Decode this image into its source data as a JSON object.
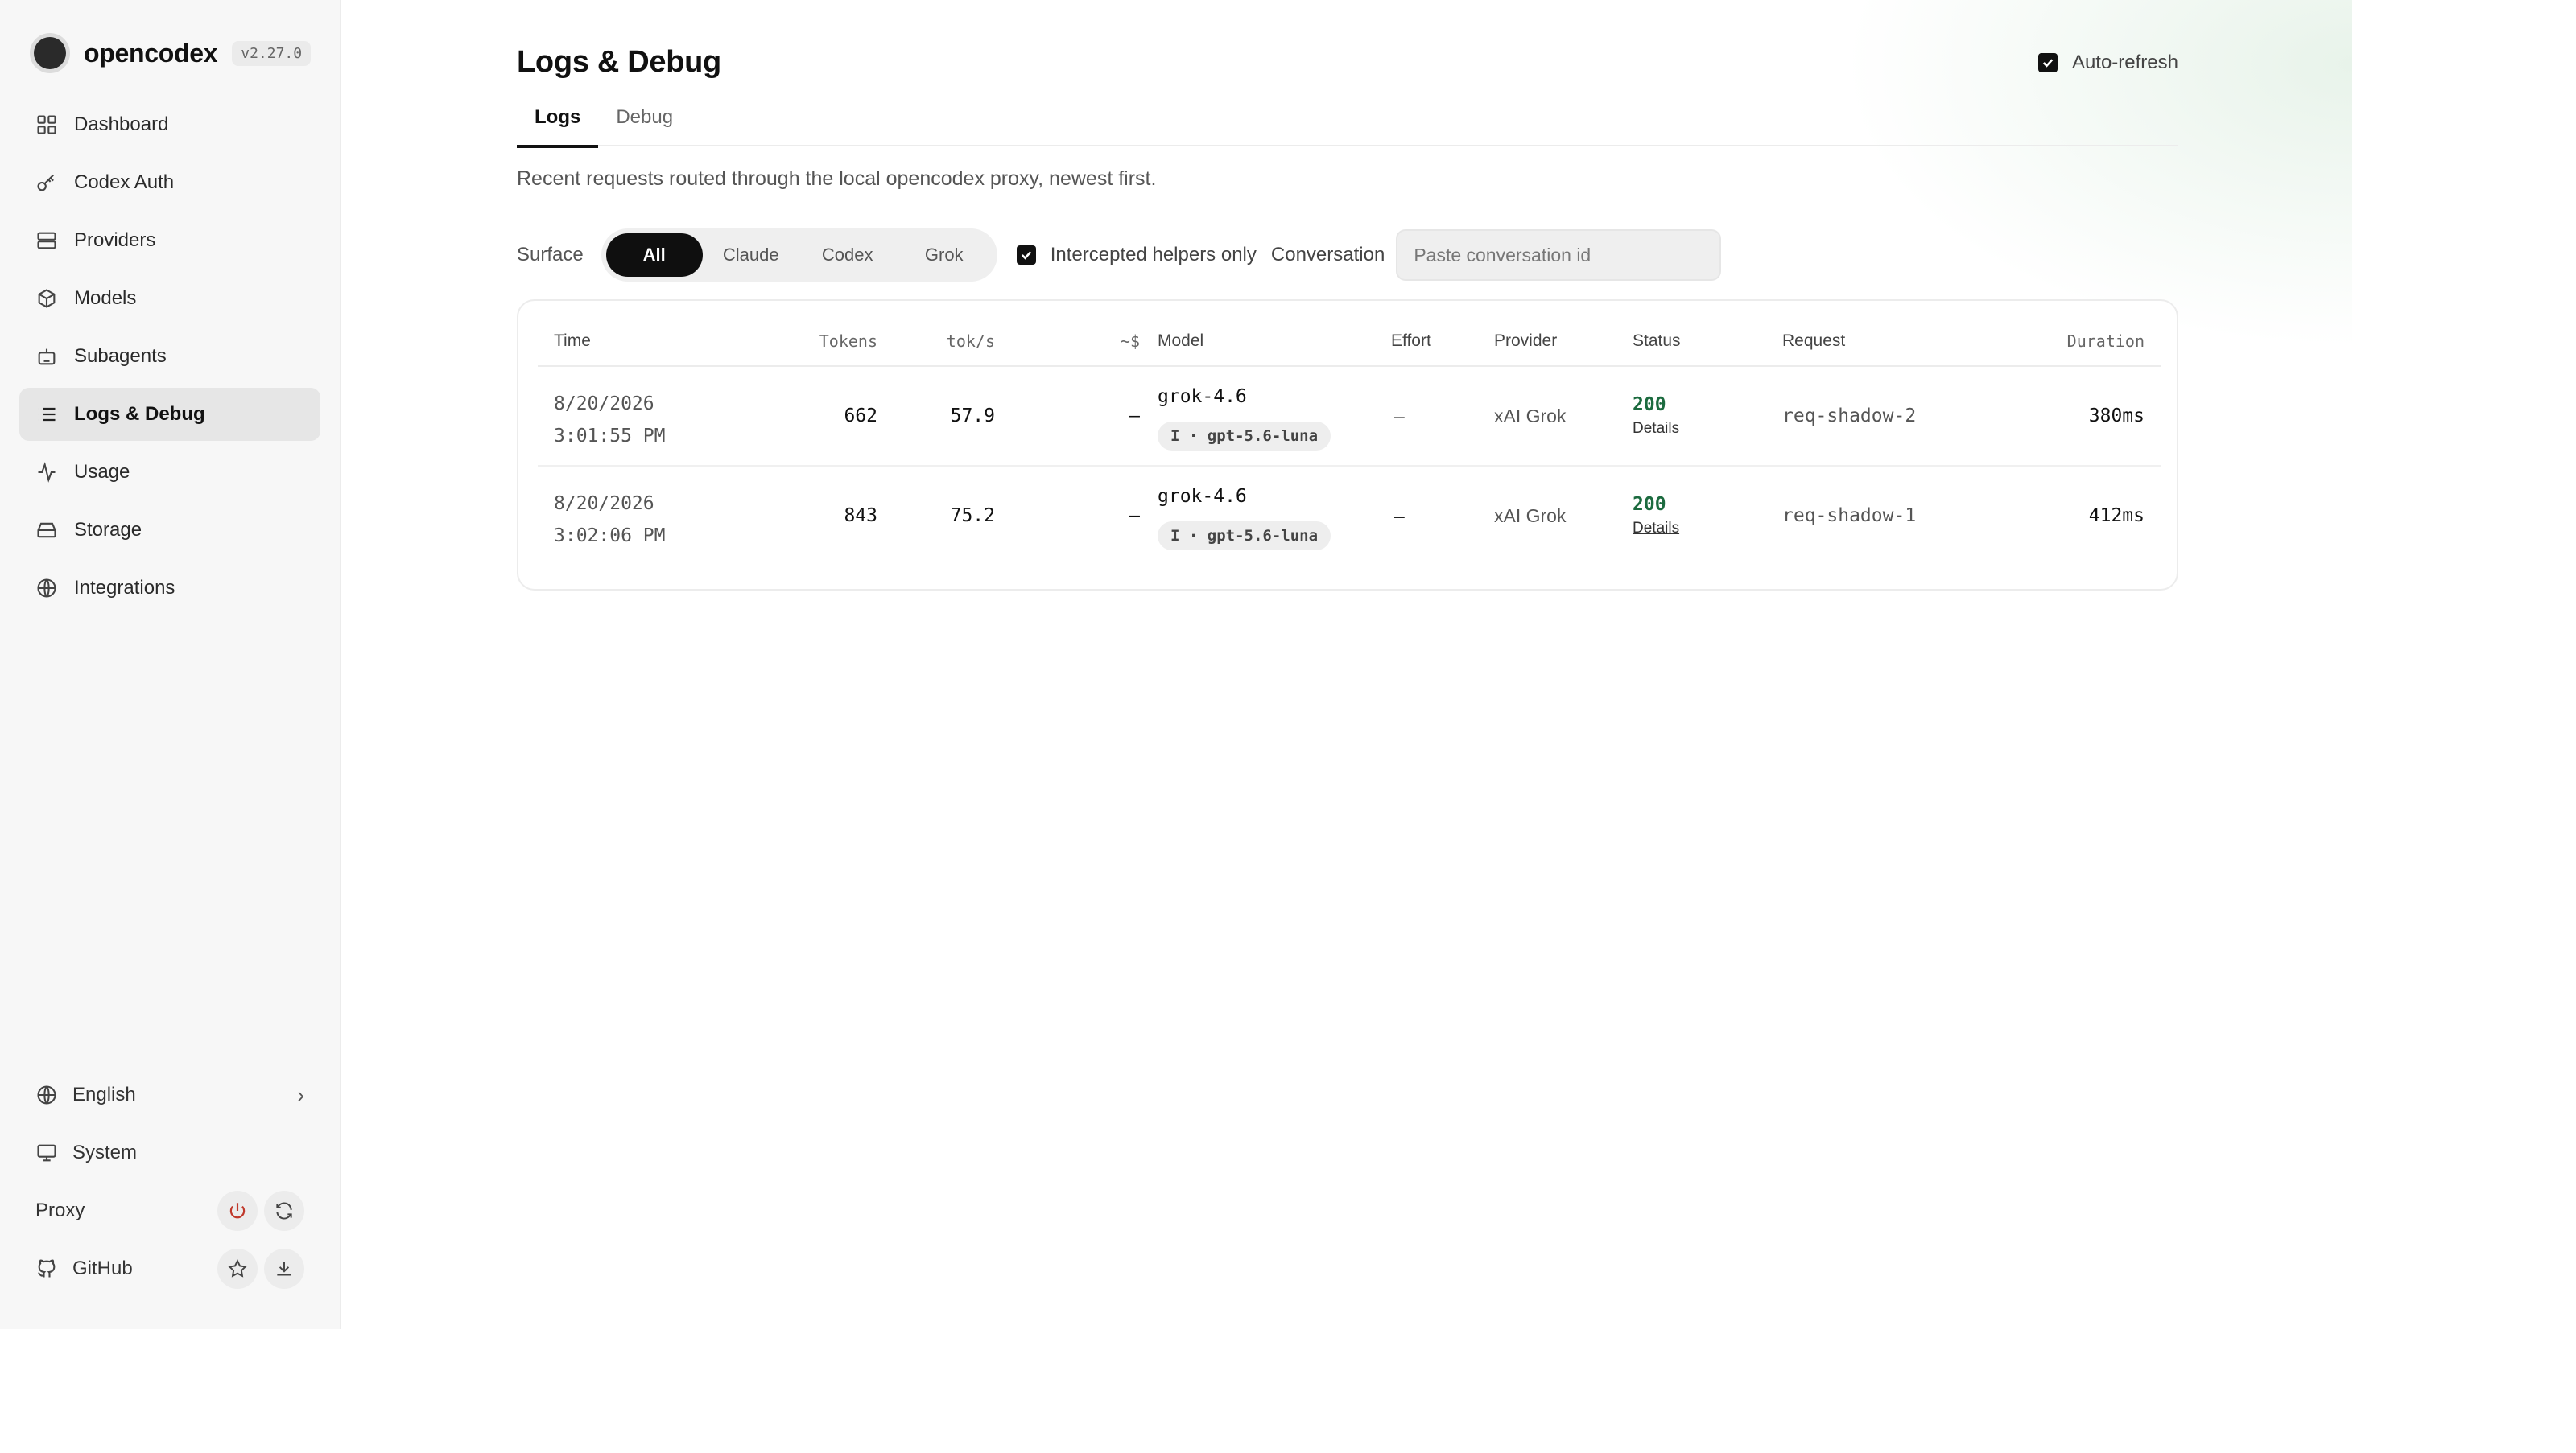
{
  "brand": {
    "name": "opencodex",
    "version": "v2.27.0"
  },
  "nav": [
    {
      "id": "dashboard",
      "label": "Dashboard",
      "icon": "dashboard-icon"
    },
    {
      "id": "codex-auth",
      "label": "Codex Auth",
      "icon": "key-icon"
    },
    {
      "id": "providers",
      "label": "Providers",
      "icon": "server-icon"
    },
    {
      "id": "models",
      "label": "Models",
      "icon": "cube-icon"
    },
    {
      "id": "subagents",
      "label": "Subagents",
      "icon": "bot-icon"
    },
    {
      "id": "logs-debug",
      "label": "Logs & Debug",
      "icon": "list-icon",
      "active": true
    },
    {
      "id": "usage",
      "label": "Usage",
      "icon": "activity-icon"
    },
    {
      "id": "storage",
      "label": "Storage",
      "icon": "storage-icon"
    },
    {
      "id": "integrations",
      "label": "Integrations",
      "icon": "globe-icon"
    }
  ],
  "sidebar_bottom": {
    "language": "English",
    "theme": "System",
    "proxy": "Proxy",
    "github": "GitHub"
  },
  "page": {
    "title": "Logs & Debug",
    "auto_refresh_label": "Auto-refresh",
    "auto_refresh_checked": true,
    "tabs": [
      {
        "label": "Logs",
        "active": true
      },
      {
        "label": "Debug",
        "active": false
      }
    ],
    "description": "Recent requests routed through the local opencodex proxy, newest first."
  },
  "filters": {
    "surface_label": "Surface",
    "surface_options": [
      "All",
      "Claude",
      "Codex",
      "Grok"
    ],
    "surface_selected": "All",
    "helpers_label": "Intercepted helpers only",
    "helpers_checked": true,
    "conversation_label": "Conversation",
    "conversation_placeholder": "Paste conversation id",
    "conversation_value": ""
  },
  "table": {
    "columns": [
      "Time",
      "Tokens",
      "tok/s",
      "~$",
      "Model",
      "Effort",
      "Provider",
      "Status",
      "Request",
      "Duration"
    ],
    "rows": [
      {
        "date": "8/20/2026",
        "time": "3:01:55 PM",
        "tokens": "662",
        "tok_s": "57.9",
        "cost": "—",
        "model": "grok-4.6",
        "model_tag": "I · gpt-5.6-luna",
        "effort": "–",
        "provider": "xAI Grok",
        "status": "200",
        "details": "Details",
        "request": "req-shadow-2",
        "duration": "380ms"
      },
      {
        "date": "8/20/2026",
        "time": "3:02:06 PM",
        "tokens": "843",
        "tok_s": "75.2",
        "cost": "—",
        "model": "grok-4.6",
        "model_tag": "I · gpt-5.6-luna",
        "effort": "–",
        "provider": "xAI Grok",
        "status": "200",
        "details": "Details",
        "request": "req-shadow-1",
        "duration": "412ms"
      }
    ]
  },
  "colors": {
    "accent": "#111111",
    "status_ok": "#1c6b3f",
    "active_nav_bg": "#e6e6e6"
  }
}
